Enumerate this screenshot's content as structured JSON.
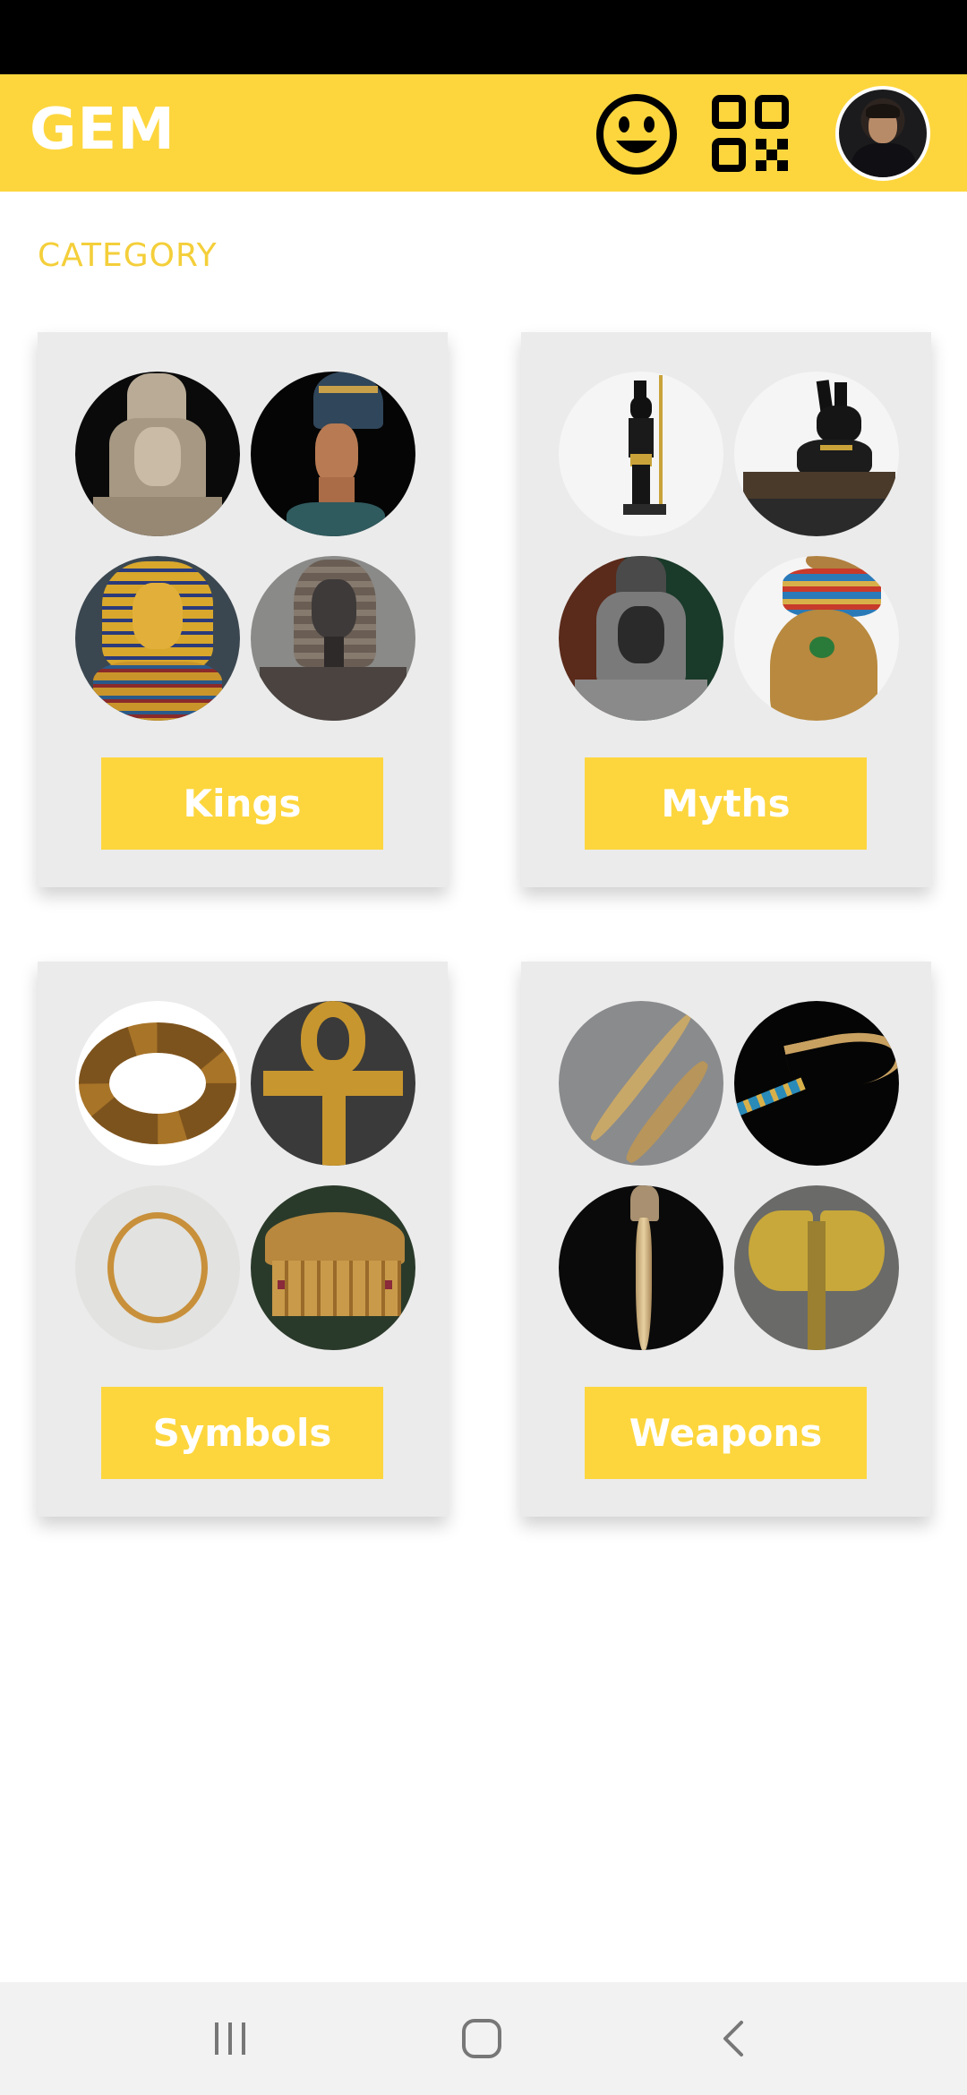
{
  "app": {
    "title": "GEM",
    "brand_color": "#FDD63E",
    "label_color": "#F4CF3A",
    "icons": [
      "smiley-face-icon",
      "qr-code-icon",
      "user-avatar"
    ]
  },
  "section": {
    "label": "CATEGORY"
  },
  "categories": [
    {
      "label": "Kings",
      "thumbnails": [
        "pharaoh-bust",
        "nefertiti-bust",
        "tutankhamun-mask",
        "pharaoh-statue"
      ]
    },
    {
      "label": "Myths",
      "thumbnails": [
        "anubis-statue",
        "anubis-jackal",
        "dark-pharaoh-statue",
        "bastet-cat"
      ]
    },
    {
      "label": "Symbols",
      "thumbnails": [
        "gold-collar-necklace",
        "golden-ankh",
        "gold-ring",
        "golden-chest"
      ]
    },
    {
      "label": "Weapons",
      "thumbnails": [
        "dagger-with-sheath",
        "khopesh-sword",
        "ceremonial-scepter",
        "double-axe"
      ]
    }
  ],
  "navigation": {
    "buttons": [
      "recents",
      "home",
      "back"
    ]
  }
}
